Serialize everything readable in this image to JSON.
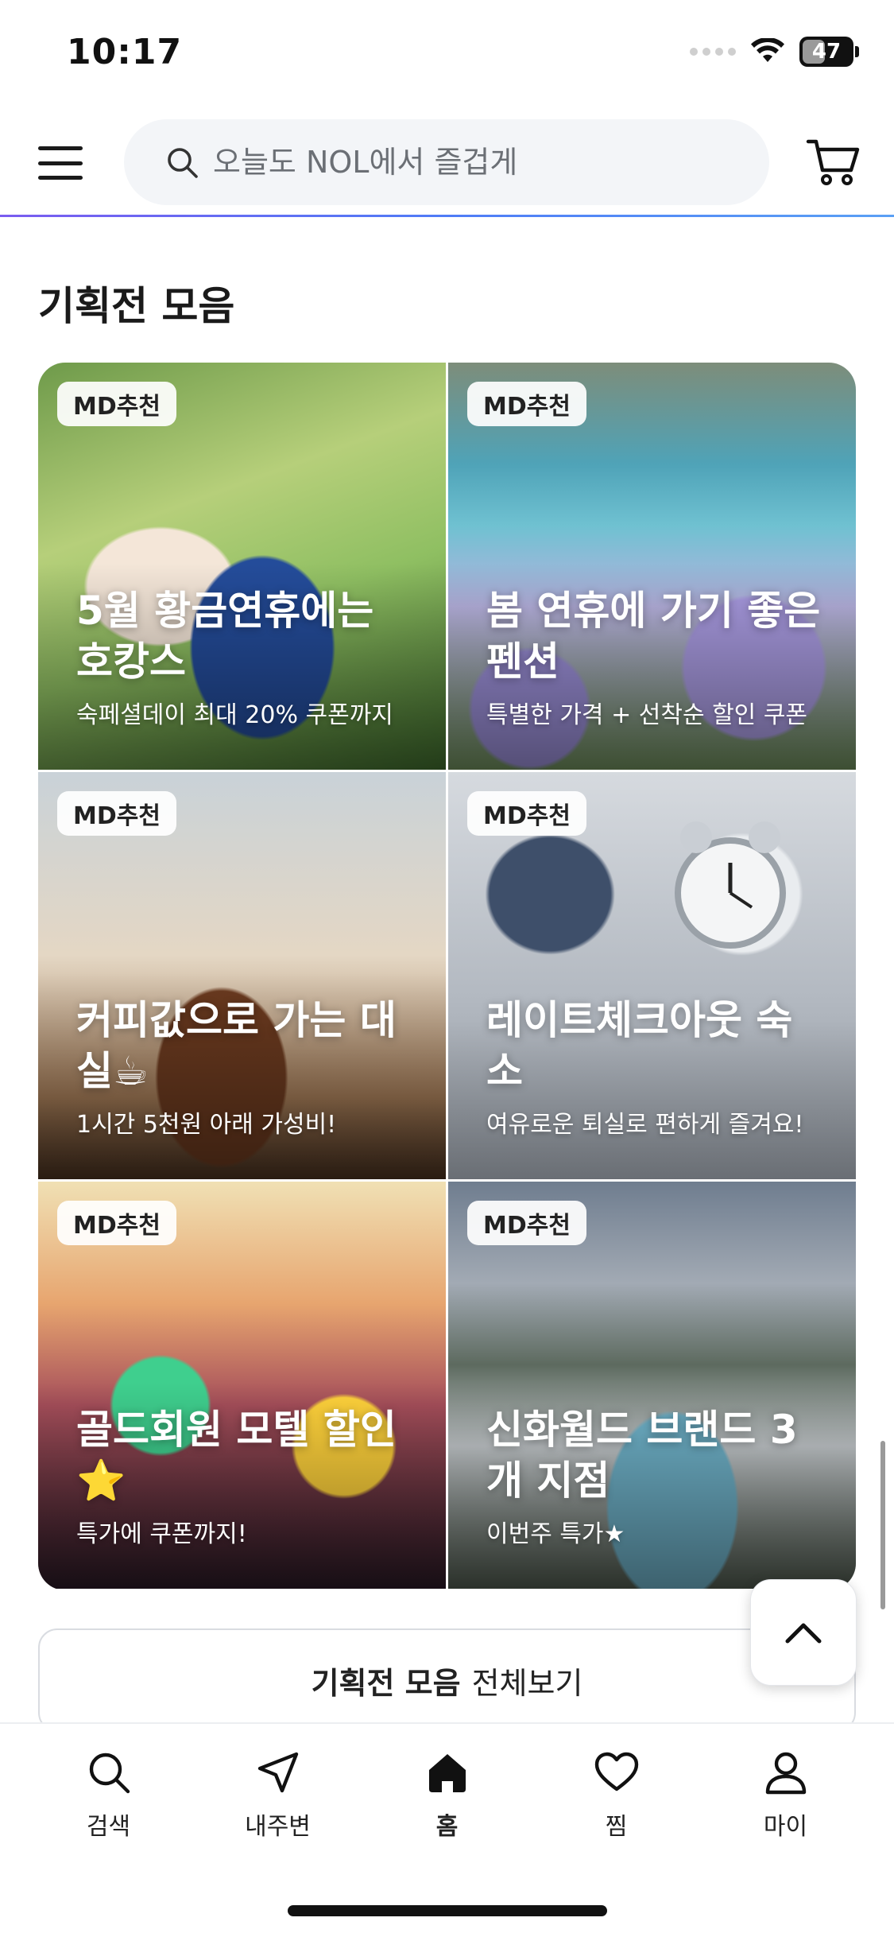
{
  "status_bar": {
    "time": "10:17",
    "battery": "47"
  },
  "search": {
    "placeholder": "오늘도 NOL에서 즐겁게"
  },
  "section": {
    "title": "기획전 모음",
    "cards": [
      {
        "badge": "MD추천",
        "title": "5월 황금연휴에는 호캉스",
        "subtitle": "숙페셜데이 최대 20% 쿠폰까지"
      },
      {
        "badge": "MD추천",
        "title": "봄 연휴에 가기 좋은 펜션",
        "subtitle": "특별한 가격 + 선착순 할인 쿠폰"
      },
      {
        "badge": "MD추천",
        "title": "커피값으로 가는 대실☕",
        "subtitle": "1시간 5천원 아래 가성비!"
      },
      {
        "badge": "MD추천",
        "title": "레이트체크아웃 숙소",
        "subtitle": "여유로운 퇴실로 편하게 즐겨요!"
      },
      {
        "badge": "MD추천",
        "title": "골드회원 모텔 할인⭐",
        "subtitle": "특가에 쿠폰까지!"
      },
      {
        "badge": "MD추천",
        "title": "신화월드 브랜드 3개 지점",
        "subtitle": "이번주 특가★"
      }
    ],
    "full_view": {
      "strong": "기획전 모음",
      "rest": "전체보기"
    }
  },
  "bottom_nav": {
    "items": [
      {
        "label": "검색",
        "icon": "search-icon"
      },
      {
        "label": "내주변",
        "icon": "navigation-arrow-icon"
      },
      {
        "label": "홈",
        "icon": "home-icon"
      },
      {
        "label": "찜",
        "icon": "heart-icon"
      },
      {
        "label": "마이",
        "icon": "person-icon"
      }
    ]
  },
  "colors": {
    "accent_line": "#5a6ff2",
    "text": "#1a1a1a"
  }
}
